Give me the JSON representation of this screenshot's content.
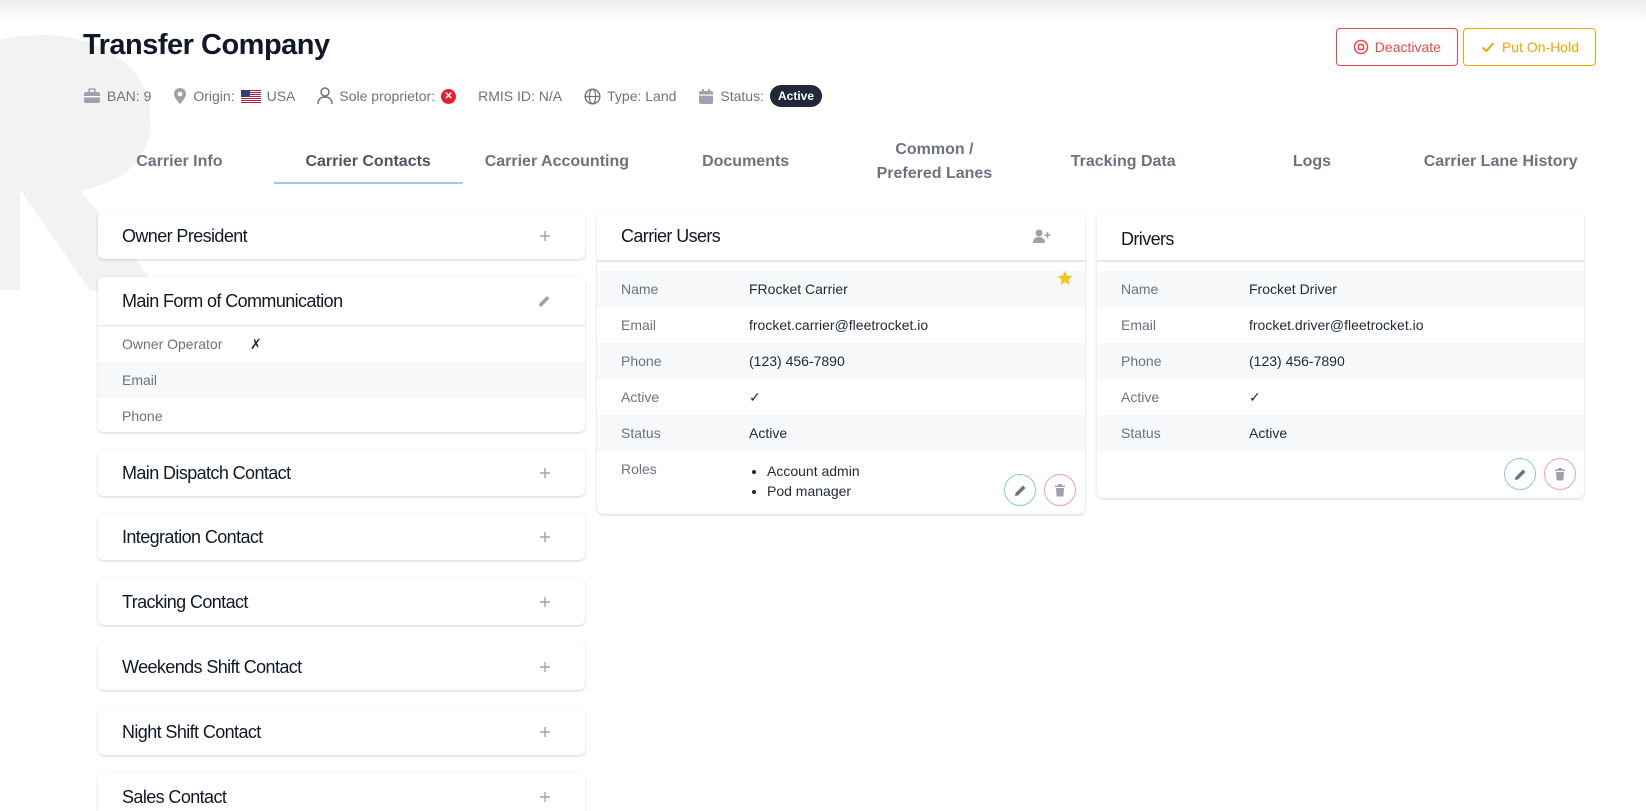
{
  "header": {
    "title": "Transfer Company",
    "deactivate_label": "Deactivate",
    "hold_label": "Put On-Hold"
  },
  "meta": {
    "ban": "BAN: 9",
    "origin_label": "Origin:",
    "origin_country": "USA",
    "sole_proprietor_label": "Sole proprietor:",
    "sole_proprietor_value": "✕",
    "rmis": "RMIS ID: N/A",
    "type": "Type: Land",
    "status_label": "Status:",
    "status_value": "Active"
  },
  "tabs": [
    {
      "label": "Carrier Info"
    },
    {
      "label": "Carrier Contacts",
      "active": true
    },
    {
      "label": "Carrier Accounting"
    },
    {
      "label": "Documents"
    },
    {
      "label": "Common / Prefered Lanes"
    },
    {
      "label": "Tracking Data"
    },
    {
      "label": "Logs"
    },
    {
      "label": "Carrier Lane History"
    }
  ],
  "contacts": {
    "owner_president": "Owner President",
    "main_form": {
      "title": "Main Form of Communication",
      "rows": [
        {
          "label": "Owner Operator",
          "value": "✗"
        },
        {
          "label": "Email",
          "value": ""
        },
        {
          "label": "Phone",
          "value": ""
        }
      ]
    },
    "main_dispatch": "Main Dispatch Contact",
    "integration": "Integration Contact",
    "tracking": "Tracking Contact",
    "weekends": "Weekends Shift Contact",
    "night": "Night Shift Contact",
    "sales": "Sales Contact"
  },
  "carrier_users": {
    "title": "Carrier Users",
    "rows": [
      {
        "label": "Name",
        "value": "FRocket Carrier"
      },
      {
        "label": "Email",
        "value": "frocket.carrier@fleetrocket.io"
      },
      {
        "label": "Phone",
        "value": "(123) 456-7890"
      },
      {
        "label": "Active",
        "value": "✓"
      },
      {
        "label": "Status",
        "value": "Active"
      }
    ],
    "roles_label": "Roles",
    "roles": [
      "Account admin",
      "Pod manager"
    ]
  },
  "drivers": {
    "title": "Drivers",
    "rows": [
      {
        "label": "Name",
        "value": "Frocket Driver"
      },
      {
        "label": "Email",
        "value": "frocket.driver@fleetrocket.io"
      },
      {
        "label": "Phone",
        "value": "(123) 456-7890"
      },
      {
        "label": "Active",
        "value": "✓"
      },
      {
        "label": "Status",
        "value": "Active"
      }
    ]
  },
  "colors": {
    "danger": "#e5484d",
    "warning": "#f0a500",
    "tab_underline": "#9dc9ea",
    "star": "#f5c518",
    "status_pill": "#1f2937"
  },
  "icons": [
    "briefcase-icon",
    "location-pin-icon",
    "us-flag-icon",
    "person-icon",
    "globe-icon",
    "calendar-icon",
    "plus-icon",
    "pencil-icon",
    "add-user-icon",
    "star-icon",
    "trash-icon",
    "stop-circle-icon",
    "check-icon"
  ]
}
